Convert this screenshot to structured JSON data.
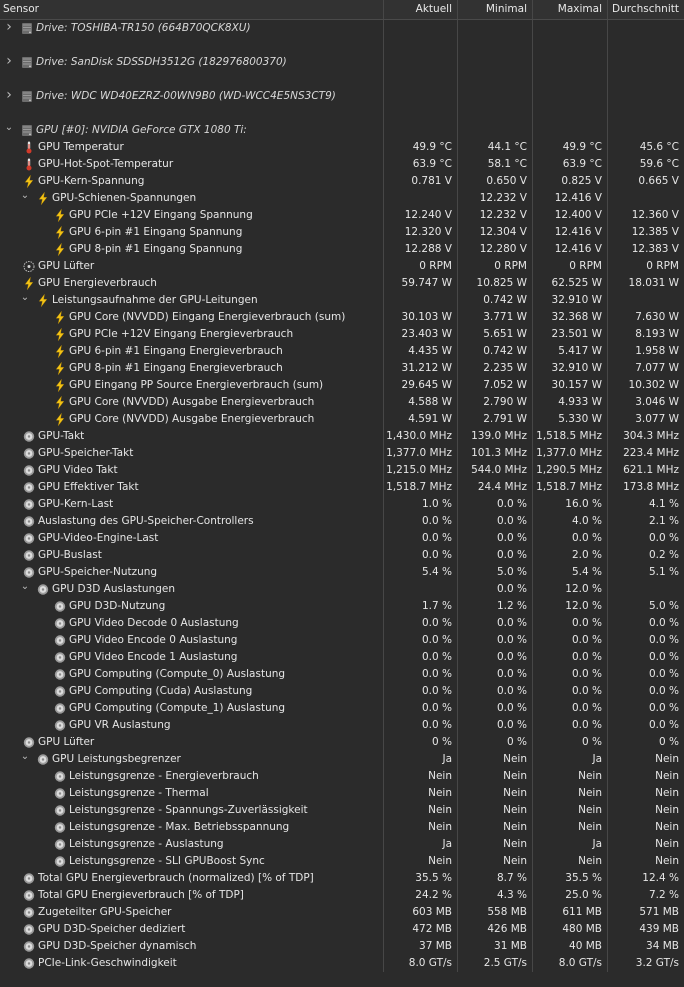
{
  "header": {
    "sensor": "Sensor",
    "current": "Aktuell",
    "min": "Minimal",
    "max": "Maximal",
    "avg": "Durchschnitt"
  },
  "rows": [
    {
      "type": "drive",
      "level": 0,
      "arrow": "›",
      "icon": "drive",
      "label": "Drive: TOSHIBA-TR150 (664B70QCK8XU)"
    },
    {
      "type": "spacer"
    },
    {
      "type": "drive",
      "level": 0,
      "arrow": "›",
      "icon": "drive",
      "label": "Drive: SanDisk SDSSDH3512G (182976800370)"
    },
    {
      "type": "spacer"
    },
    {
      "type": "drive",
      "level": 0,
      "arrow": "›",
      "icon": "drive",
      "label": "Drive: WDC WD40EZRZ-00WN9B0 (WD-WCC4E5NS3CT9)"
    },
    {
      "type": "spacer"
    },
    {
      "type": "gpu",
      "level": 0,
      "arrow": "⌄",
      "icon": "drive",
      "label": "GPU [#0]: NVIDIA GeForce GTX 1080 Ti:"
    },
    {
      "level": 0,
      "icon": "thermo",
      "label": "GPU Temperatur",
      "cur": "49.9 °C",
      "min": "44.1 °C",
      "max": "49.9 °C",
      "avg": "45.6 °C"
    },
    {
      "level": 0,
      "icon": "thermo",
      "label": "GPU-Hot-Spot-Temperatur",
      "cur": "63.9 °C",
      "min": "58.1 °C",
      "max": "63.9 °C",
      "avg": "59.6 °C"
    },
    {
      "level": 0,
      "icon": "bolt",
      "label": "GPU-Kern-Spannung",
      "cur": "0.781 V",
      "min": "0.650 V",
      "max": "0.825 V",
      "avg": "0.665 V"
    },
    {
      "level": 1,
      "arrow": "⌄",
      "icon": "bolt",
      "label": "GPU-Schienen-Spannungen",
      "cur": "",
      "min": "12.232 V",
      "max": "12.416 V",
      "avg": ""
    },
    {
      "level": 2,
      "icon": "bolt",
      "label": "GPU PCIe +12V Eingang Spannung",
      "cur": "12.240 V",
      "min": "12.232 V",
      "max": "12.400 V",
      "avg": "12.360 V"
    },
    {
      "level": 2,
      "icon": "bolt",
      "label": "GPU 6-pin #1 Eingang Spannung",
      "cur": "12.320 V",
      "min": "12.304 V",
      "max": "12.416 V",
      "avg": "12.385 V"
    },
    {
      "level": 2,
      "icon": "bolt",
      "label": "GPU 8-pin #1 Eingang Spannung",
      "cur": "12.288 V",
      "min": "12.280 V",
      "max": "12.416 V",
      "avg": "12.383 V"
    },
    {
      "level": 0,
      "icon": "fan",
      "label": "GPU Lüfter",
      "cur": "0 RPM",
      "min": "0 RPM",
      "max": "0 RPM",
      "avg": "0 RPM"
    },
    {
      "level": 0,
      "icon": "bolt",
      "label": "GPU Energieverbrauch",
      "cur": "59.747 W",
      "min": "10.825 W",
      "max": "62.525 W",
      "avg": "18.031 W"
    },
    {
      "level": 1,
      "arrow": "⌄",
      "icon": "bolt",
      "label": "Leistungsaufnahme der GPU-Leitungen",
      "cur": "",
      "min": "0.742 W",
      "max": "32.910 W",
      "avg": ""
    },
    {
      "level": 2,
      "icon": "bolt",
      "label": "GPU Core (NVVDD) Eingang Energieverbrauch (sum)",
      "cur": "30.103 W",
      "min": "3.771 W",
      "max": "32.368 W",
      "avg": "7.630 W"
    },
    {
      "level": 2,
      "icon": "bolt",
      "label": "GPU PCIe +12V Eingang Energieverbrauch",
      "cur": "23.403 W",
      "min": "5.651 W",
      "max": "23.501 W",
      "avg": "8.193 W"
    },
    {
      "level": 2,
      "icon": "bolt",
      "label": "GPU 6-pin #1 Eingang Energieverbrauch",
      "cur": "4.435 W",
      "min": "0.742 W",
      "max": "5.417 W",
      "avg": "1.958 W"
    },
    {
      "level": 2,
      "icon": "bolt",
      "label": "GPU 8-pin #1 Eingang Energieverbrauch",
      "cur": "31.212 W",
      "min": "2.235 W",
      "max": "32.910 W",
      "avg": "7.077 W"
    },
    {
      "level": 2,
      "icon": "bolt",
      "label": "GPU Eingang PP Source Energieverbrauch (sum)",
      "cur": "29.645 W",
      "min": "7.052 W",
      "max": "30.157 W",
      "avg": "10.302 W"
    },
    {
      "level": 2,
      "icon": "bolt",
      "label": "GPU Core (NVVDD) Ausgabe Energieverbrauch",
      "cur": "4.588 W",
      "min": "2.790 W",
      "max": "4.933 W",
      "avg": "3.046 W"
    },
    {
      "level": 2,
      "icon": "bolt",
      "label": "GPU Core (NVVDD) Ausgabe Energieverbrauch",
      "cur": "4.591 W",
      "min": "2.791 W",
      "max": "5.330 W",
      "avg": "3.077 W"
    },
    {
      "level": 0,
      "icon": "gauge",
      "label": "GPU-Takt",
      "cur": "1,430.0 MHz",
      "min": "139.0 MHz",
      "max": "1,518.5 MHz",
      "avg": "304.3 MHz"
    },
    {
      "level": 0,
      "icon": "gauge",
      "label": "GPU-Speicher-Takt",
      "cur": "1,377.0 MHz",
      "min": "101.3 MHz",
      "max": "1,377.0 MHz",
      "avg": "223.4 MHz"
    },
    {
      "level": 0,
      "icon": "gauge",
      "label": "GPU Video Takt",
      "cur": "1,215.0 MHz",
      "min": "544.0 MHz",
      "max": "1,290.5 MHz",
      "avg": "621.1 MHz"
    },
    {
      "level": 0,
      "icon": "gauge",
      "label": "GPU Effektiver Takt",
      "cur": "1,518.7 MHz",
      "min": "24.4 MHz",
      "max": "1,518.7 MHz",
      "avg": "173.8 MHz"
    },
    {
      "level": 0,
      "icon": "gauge",
      "label": "GPU-Kern-Last",
      "cur": "1.0 %",
      "min": "0.0 %",
      "max": "16.0 %",
      "avg": "4.1 %"
    },
    {
      "level": 0,
      "icon": "gauge",
      "label": "Auslastung des GPU-Speicher-Controllers",
      "cur": "0.0 %",
      "min": "0.0 %",
      "max": "4.0 %",
      "avg": "2.1 %"
    },
    {
      "level": 0,
      "icon": "gauge",
      "label": "GPU-Video-Engine-Last",
      "cur": "0.0 %",
      "min": "0.0 %",
      "max": "0.0 %",
      "avg": "0.0 %"
    },
    {
      "level": 0,
      "icon": "gauge",
      "label": "GPU-Buslast",
      "cur": "0.0 %",
      "min": "0.0 %",
      "max": "2.0 %",
      "avg": "0.2 %"
    },
    {
      "level": 0,
      "icon": "gauge",
      "label": "GPU-Speicher-Nutzung",
      "cur": "5.4 %",
      "min": "5.0 %",
      "max": "5.4 %",
      "avg": "5.1 %"
    },
    {
      "level": 1,
      "arrow": "⌄",
      "icon": "gauge",
      "label": "GPU D3D Auslastungen",
      "cur": "",
      "min": "0.0 %",
      "max": "12.0 %",
      "avg": ""
    },
    {
      "level": 2,
      "icon": "gauge",
      "label": "GPU D3D-Nutzung",
      "cur": "1.7 %",
      "min": "1.2 %",
      "max": "12.0 %",
      "avg": "5.0 %"
    },
    {
      "level": 2,
      "icon": "gauge",
      "label": "GPU Video Decode 0 Auslastung",
      "cur": "0.0 %",
      "min": "0.0 %",
      "max": "0.0 %",
      "avg": "0.0 %"
    },
    {
      "level": 2,
      "icon": "gauge",
      "label": "GPU Video Encode 0 Auslastung",
      "cur": "0.0 %",
      "min": "0.0 %",
      "max": "0.0 %",
      "avg": "0.0 %"
    },
    {
      "level": 2,
      "icon": "gauge",
      "label": "GPU Video Encode 1 Auslastung",
      "cur": "0.0 %",
      "min": "0.0 %",
      "max": "0.0 %",
      "avg": "0.0 %"
    },
    {
      "level": 2,
      "icon": "gauge",
      "label": "GPU Computing (Compute_0) Auslastung",
      "cur": "0.0 %",
      "min": "0.0 %",
      "max": "0.0 %",
      "avg": "0.0 %"
    },
    {
      "level": 2,
      "icon": "gauge",
      "label": "GPU Computing (Cuda) Auslastung",
      "cur": "0.0 %",
      "min": "0.0 %",
      "max": "0.0 %",
      "avg": "0.0 %"
    },
    {
      "level": 2,
      "icon": "gauge",
      "label": "GPU Computing (Compute_1) Auslastung",
      "cur": "0.0 %",
      "min": "0.0 %",
      "max": "0.0 %",
      "avg": "0.0 %"
    },
    {
      "level": 2,
      "icon": "gauge",
      "label": "GPU VR Auslastung",
      "cur": "0.0 %",
      "min": "0.0 %",
      "max": "0.0 %",
      "avg": "0.0 %"
    },
    {
      "level": 0,
      "icon": "gauge",
      "label": "GPU Lüfter",
      "cur": "0 %",
      "min": "0 %",
      "max": "0 %",
      "avg": "0 %"
    },
    {
      "level": 1,
      "arrow": "⌄",
      "icon": "gauge",
      "label": "GPU Leistungsbegrenzer",
      "cur": "Ja",
      "min": "Nein",
      "max": "Ja",
      "avg": "Nein"
    },
    {
      "level": 2,
      "icon": "gauge",
      "label": "Leistungsgrenze - Energieverbrauch",
      "cur": "Nein",
      "min": "Nein",
      "max": "Nein",
      "avg": "Nein"
    },
    {
      "level": 2,
      "icon": "gauge",
      "label": "Leistungsgrenze - Thermal",
      "cur": "Nein",
      "min": "Nein",
      "max": "Nein",
      "avg": "Nein"
    },
    {
      "level": 2,
      "icon": "gauge",
      "label": "Leistungsgrenze - Spannungs-Zuverlässigkeit",
      "cur": "Nein",
      "min": "Nein",
      "max": "Nein",
      "avg": "Nein"
    },
    {
      "level": 2,
      "icon": "gauge",
      "label": "Leistungsgrenze - Max. Betriebsspannung",
      "cur": "Nein",
      "min": "Nein",
      "max": "Nein",
      "avg": "Nein"
    },
    {
      "level": 2,
      "icon": "gauge",
      "label": "Leistungsgrenze - Auslastung",
      "cur": "Ja",
      "min": "Nein",
      "max": "Ja",
      "avg": "Nein"
    },
    {
      "level": 2,
      "icon": "gauge",
      "label": "Leistungsgrenze - SLI GPUBoost Sync",
      "cur": "Nein",
      "min": "Nein",
      "max": "Nein",
      "avg": "Nein"
    },
    {
      "level": 0,
      "icon": "gauge",
      "label": "Total GPU Energieverbrauch (normalized) [% of TDP]",
      "cur": "35.5 %",
      "min": "8.7 %",
      "max": "35.5 %",
      "avg": "12.4 %"
    },
    {
      "level": 0,
      "icon": "gauge",
      "label": "Total GPU Energieverbrauch [% of TDP]",
      "cur": "24.2 %",
      "min": "4.3 %",
      "max": "25.0 %",
      "avg": "7.2 %"
    },
    {
      "level": 0,
      "icon": "gauge",
      "label": "Zugeteilter GPU-Speicher",
      "cur": "603 MB",
      "min": "558 MB",
      "max": "611 MB",
      "avg": "571 MB"
    },
    {
      "level": 0,
      "icon": "gauge",
      "label": "GPU D3D-Speicher dediziert",
      "cur": "472 MB",
      "min": "426 MB",
      "max": "480 MB",
      "avg": "439 MB"
    },
    {
      "level": 0,
      "icon": "gauge",
      "label": "GPU D3D-Speicher dynamisch",
      "cur": "37 MB",
      "min": "31 MB",
      "max": "40 MB",
      "avg": "34 MB"
    },
    {
      "level": 0,
      "icon": "gauge",
      "label": "PCIe-Link-Geschwindigkeit",
      "cur": "8.0 GT/s",
      "min": "2.5 GT/s",
      "max": "8.0 GT/s",
      "avg": "3.2 GT/s"
    }
  ]
}
